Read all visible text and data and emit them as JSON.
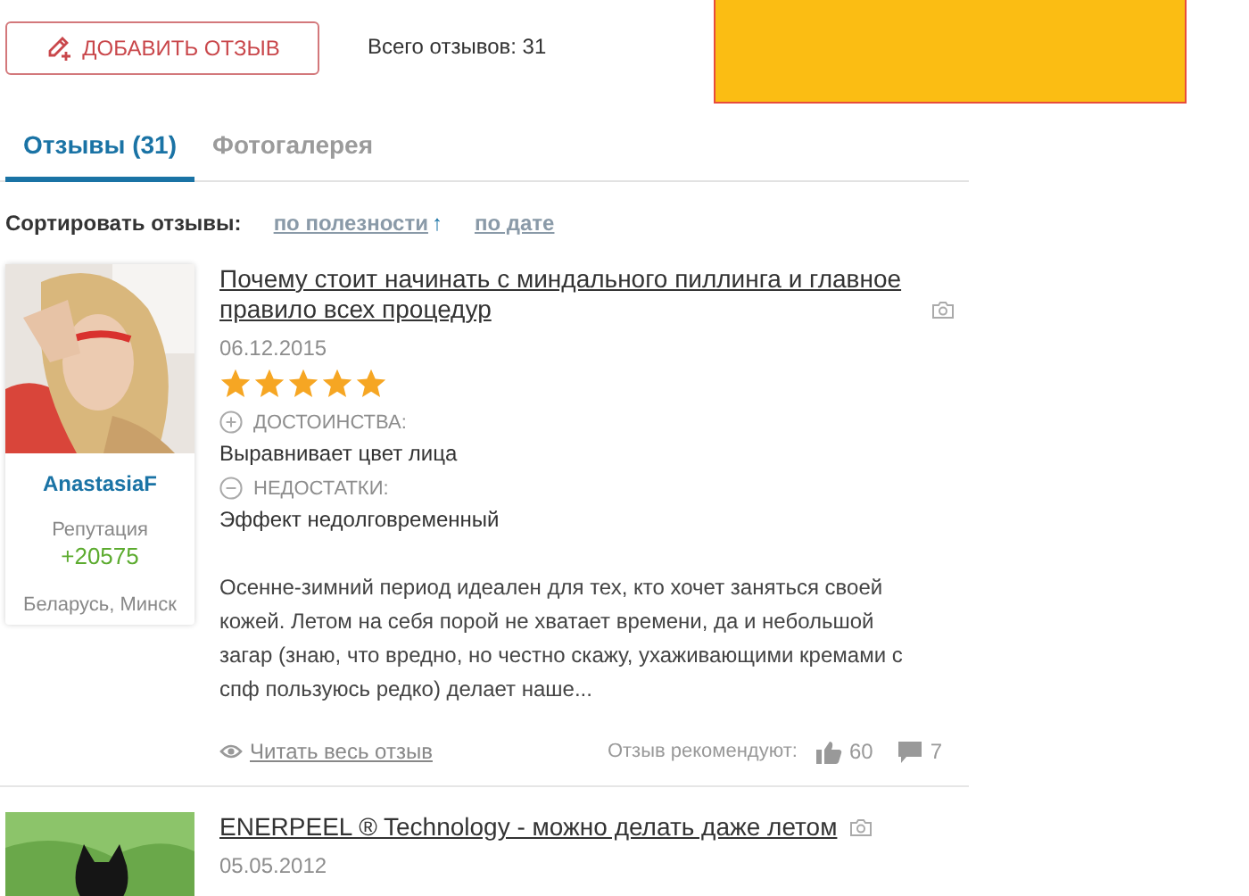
{
  "header": {
    "add_button": "ДОБАВИТЬ ОТЗЫВ",
    "total": "Всего отзывов: 31",
    "ad": {
      "kind": "banner"
    }
  },
  "tabs": [
    {
      "label": "Отзывы (31)",
      "selected": true
    },
    {
      "label": "Фотогалерея",
      "selected": false
    }
  ],
  "sort": {
    "label": "Сортировать отзывы:",
    "options": [
      {
        "label": "по полезности",
        "arrow": "↑"
      },
      {
        "label": "по дате"
      }
    ]
  },
  "reviews": [
    {
      "author": {
        "name": "AnastasiaF",
        "reputation_label": "Репутация",
        "reputation": "+20575",
        "location": "Беларусь, Минск"
      },
      "title": "Почему стоит начинать с миндального пиллинга и главное правило всех процедур",
      "has_photos": true,
      "date": "06.12.2015",
      "stars": 5,
      "pros_label": "ДОСТОИНСТВА:",
      "pros": "Выравнивает цвет лица",
      "cons_label": "НЕДОСТАТКИ:",
      "cons": "Эффект недолговременный",
      "text": "Осенне-зимний период идеален для тех, кто хочет заняться своей кожей. Летом на себя порой не хватает времени, да и небольшой загар (знаю, что вредно, но честно скажу, ухаживающими кремами с спф пользуюсь редко) делает наше...",
      "read_more": "Читать весь отзыв",
      "recommend_label": "Отзыв рекомендуют:",
      "likes": "60",
      "comments": "7"
    },
    {
      "title": "ENERPEEL ® Technology - можно делать даже летом",
      "has_photos": true,
      "date": "05.05.2012"
    }
  ]
}
